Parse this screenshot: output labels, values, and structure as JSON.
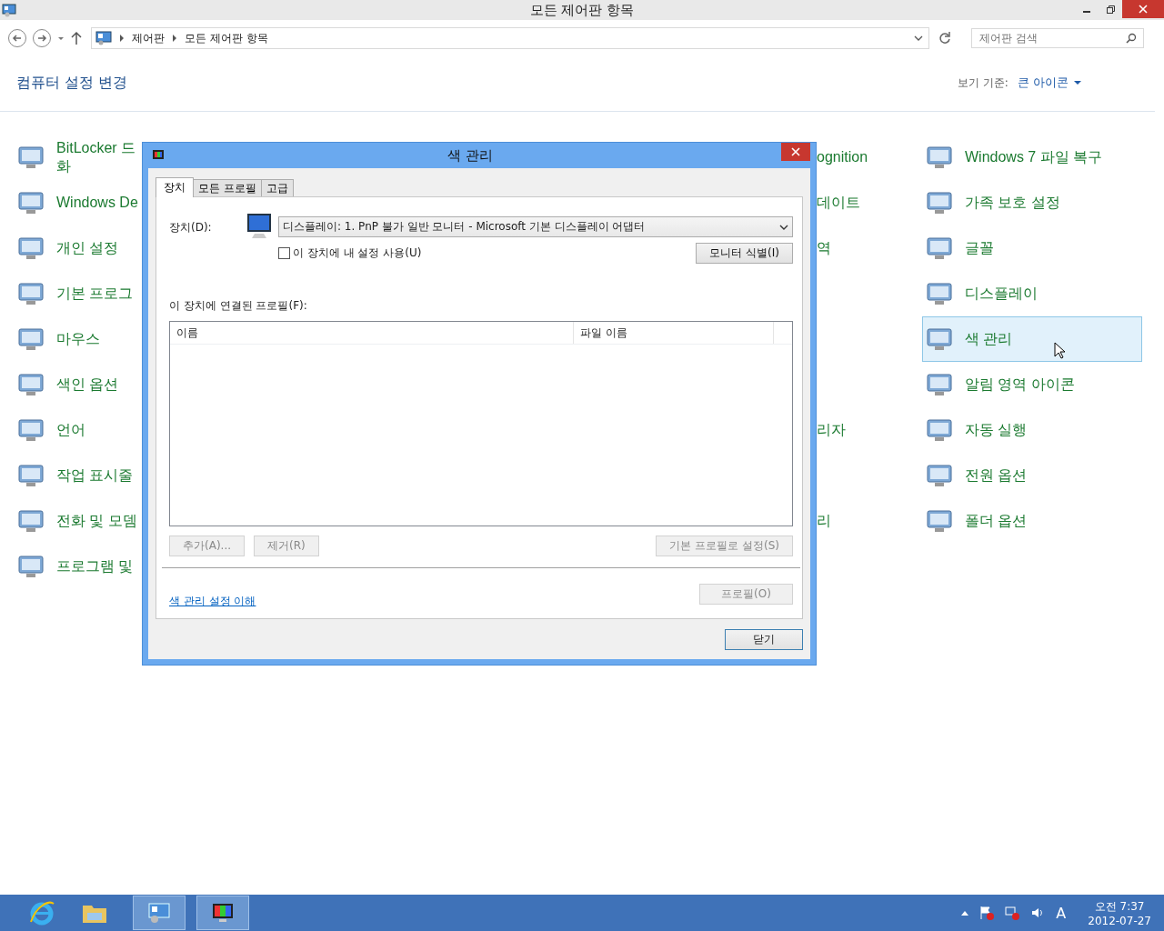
{
  "window": {
    "title": "모든 제어판 항목"
  },
  "address": {
    "crumbs": [
      "제어판",
      "모든 제어판 항목"
    ]
  },
  "search": {
    "placeholder": "제어판 검색"
  },
  "header": {
    "title": "컴퓨터 설정 변경",
    "view_label": "보기 기준:",
    "view_value": "큰 아이콘"
  },
  "rows": [
    {
      "left": [
        "BitLocker 드",
        "화"
      ],
      "middle": "ognition",
      "right": {
        "label": "Windows 7 파일 복구",
        "selected": false
      }
    },
    {
      "left": [
        "Windows De"
      ],
      "middle": "데이트",
      "right": {
        "label": "가족 보호 설정",
        "selected": false
      }
    },
    {
      "left": [
        "개인 설정"
      ],
      "middle": "역",
      "right": {
        "label": "글꼴",
        "selected": false
      }
    },
    {
      "left": [
        "기본 프로그"
      ],
      "right": {
        "label": "디스플레이",
        "selected": false
      }
    },
    {
      "left": [
        "마우스"
      ],
      "right": {
        "label": "색 관리",
        "selected": true
      }
    },
    {
      "left": [
        "색인 옵션"
      ],
      "right": {
        "label": "알림 영역 아이콘",
        "selected": false
      }
    },
    {
      "left": [
        "언어"
      ],
      "middle": "리자",
      "right": {
        "label": "자동 실행",
        "selected": false
      }
    },
    {
      "left": [
        "작업 표시줄"
      ],
      "right": {
        "label": "전원 옵션",
        "selected": false
      }
    },
    {
      "left": [
        "전화 및 모뎀"
      ],
      "middle": "리",
      "right": {
        "label": "폴더 옵션",
        "selected": false
      }
    },
    {
      "left": [
        "프로그램 및"
      ]
    }
  ],
  "dialog": {
    "title": "색 관리",
    "tabs": [
      {
        "label": "장치",
        "selected": true
      },
      {
        "label": "모든 프로필",
        "selected": false
      },
      {
        "label": "고급",
        "selected": false
      }
    ],
    "device_label": "장치(D):",
    "device_value": "디스플레이: 1. PnP 불가 일반 모니터 - Microsoft 기본 디스플레이 어댑터",
    "use_settings": {
      "label": "이 장치에 내 설정 사용(U)",
      "checked": false
    },
    "identify_button": {
      "label": "모니터 식별(I)",
      "disabled": false
    },
    "profiles_label": "이 장치에 연결된 프로필(F):",
    "columns": [
      "이름",
      "파일 이름"
    ],
    "list_buttons": [
      {
        "label": "추가(A)...",
        "disabled": true
      },
      {
        "label": "제거(R)",
        "disabled": true
      },
      {
        "label": "기본 프로필로 설정(S)",
        "disabled": true
      }
    ],
    "link": "색 관리 설정 이해",
    "profiles_button": {
      "label": "프로필(O)",
      "disabled": true
    },
    "close_button": "닫기"
  },
  "taskbar": {
    "ime": "A",
    "time": "오전 7:37",
    "date": "2012-07-27"
  }
}
